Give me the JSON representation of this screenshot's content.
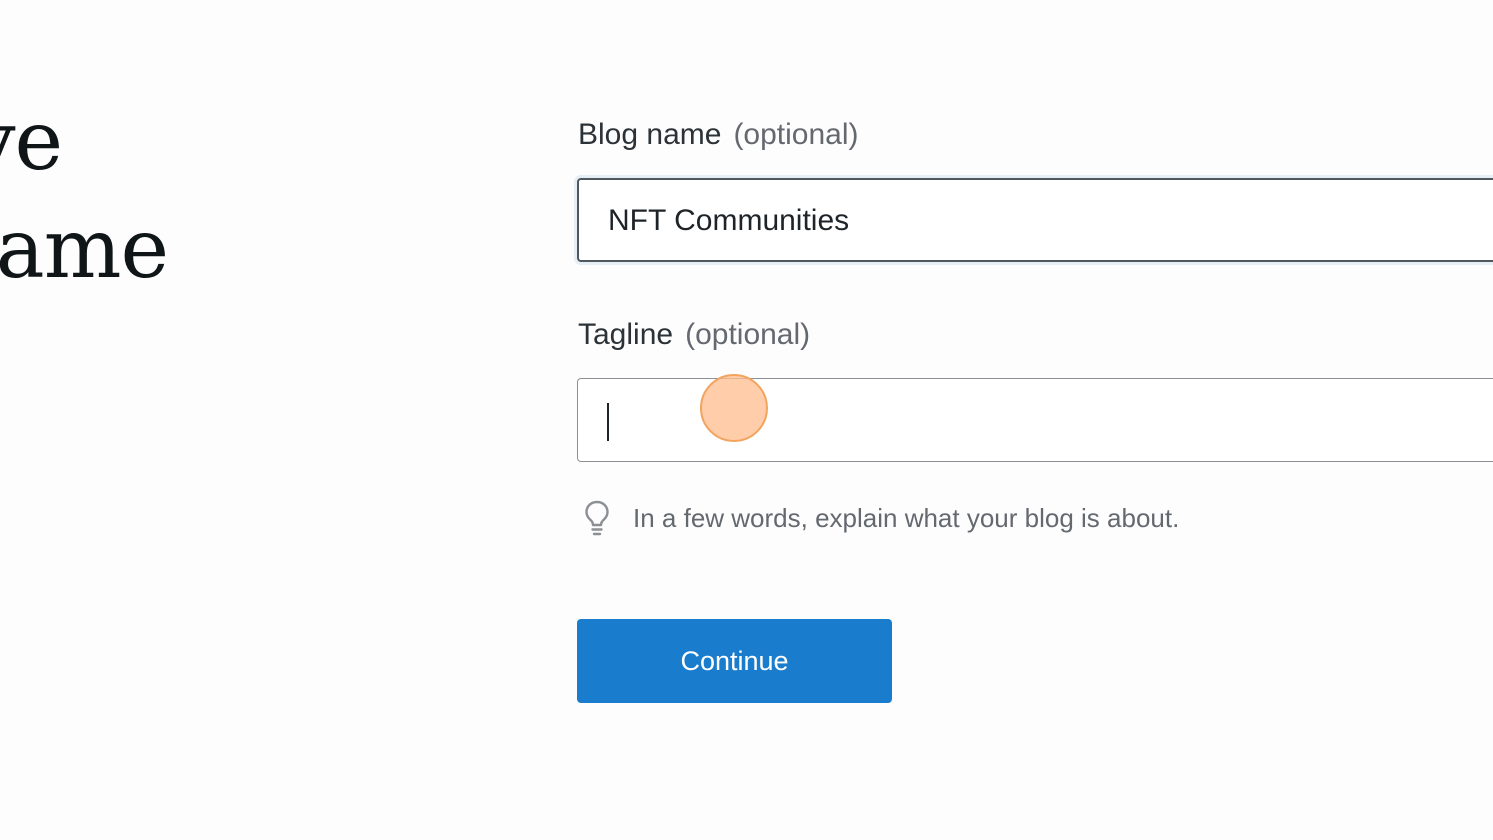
{
  "heading": {
    "line1": "ive",
    "line2": "name"
  },
  "form": {
    "blog_name": {
      "label": "Blog name",
      "optional": "(optional)",
      "value": "NFT Communities"
    },
    "tagline": {
      "label": "Tagline",
      "optional": "(optional)",
      "value": "",
      "hint": "In a few words, explain what your blog is about.",
      "hint_icon": "lightbulb-icon"
    },
    "continue_label": "Continue"
  },
  "colors": {
    "primary_button": "#1a7ccc",
    "pointer": "#ffbc8c"
  }
}
